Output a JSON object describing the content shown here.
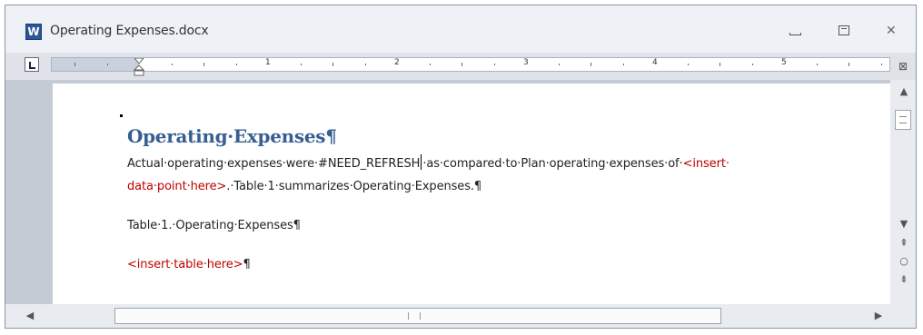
{
  "window": {
    "app_icon_letter": "W",
    "title": "Operating Expenses.docx",
    "minimize_label": "minimize",
    "maximize_label": "maximize",
    "close_label": "close"
  },
  "ruler": {
    "numbers": [
      "1",
      "2",
      "3",
      "4",
      "5"
    ]
  },
  "document": {
    "heading": "Operating·Expenses¶",
    "para1_a": "Actual·operating·expenses·were·#NEED_REFRESH",
    "para1_b": "·as·compared·to·Plan·operating·expenses·of·",
    "para1_c": "<insert·",
    "para2_a": "data·point·here>",
    "para2_b": ".·Table·1·summarizes·Operating·Expenses.¶",
    "caption": "Table·1.·Operating·Expenses¶",
    "table_placeholder": "<insert·table·here>",
    "table_placeholder_mark": "¶"
  },
  "colors": {
    "heading": "#365f91",
    "placeholder": "#c00000",
    "text": "#222222"
  },
  "icons": {
    "app": "word-icon",
    "min": "minimize-icon",
    "max": "maximize-icon",
    "close": "close-icon",
    "scroll_up": "arrow-up-icon",
    "scroll_down": "arrow-down-icon",
    "prev_page": "previous-page-icon",
    "browse_object": "select-browse-object-icon",
    "next_page": "next-page-icon",
    "scroll_left": "arrow-left-icon",
    "scroll_right": "arrow-right-icon"
  }
}
